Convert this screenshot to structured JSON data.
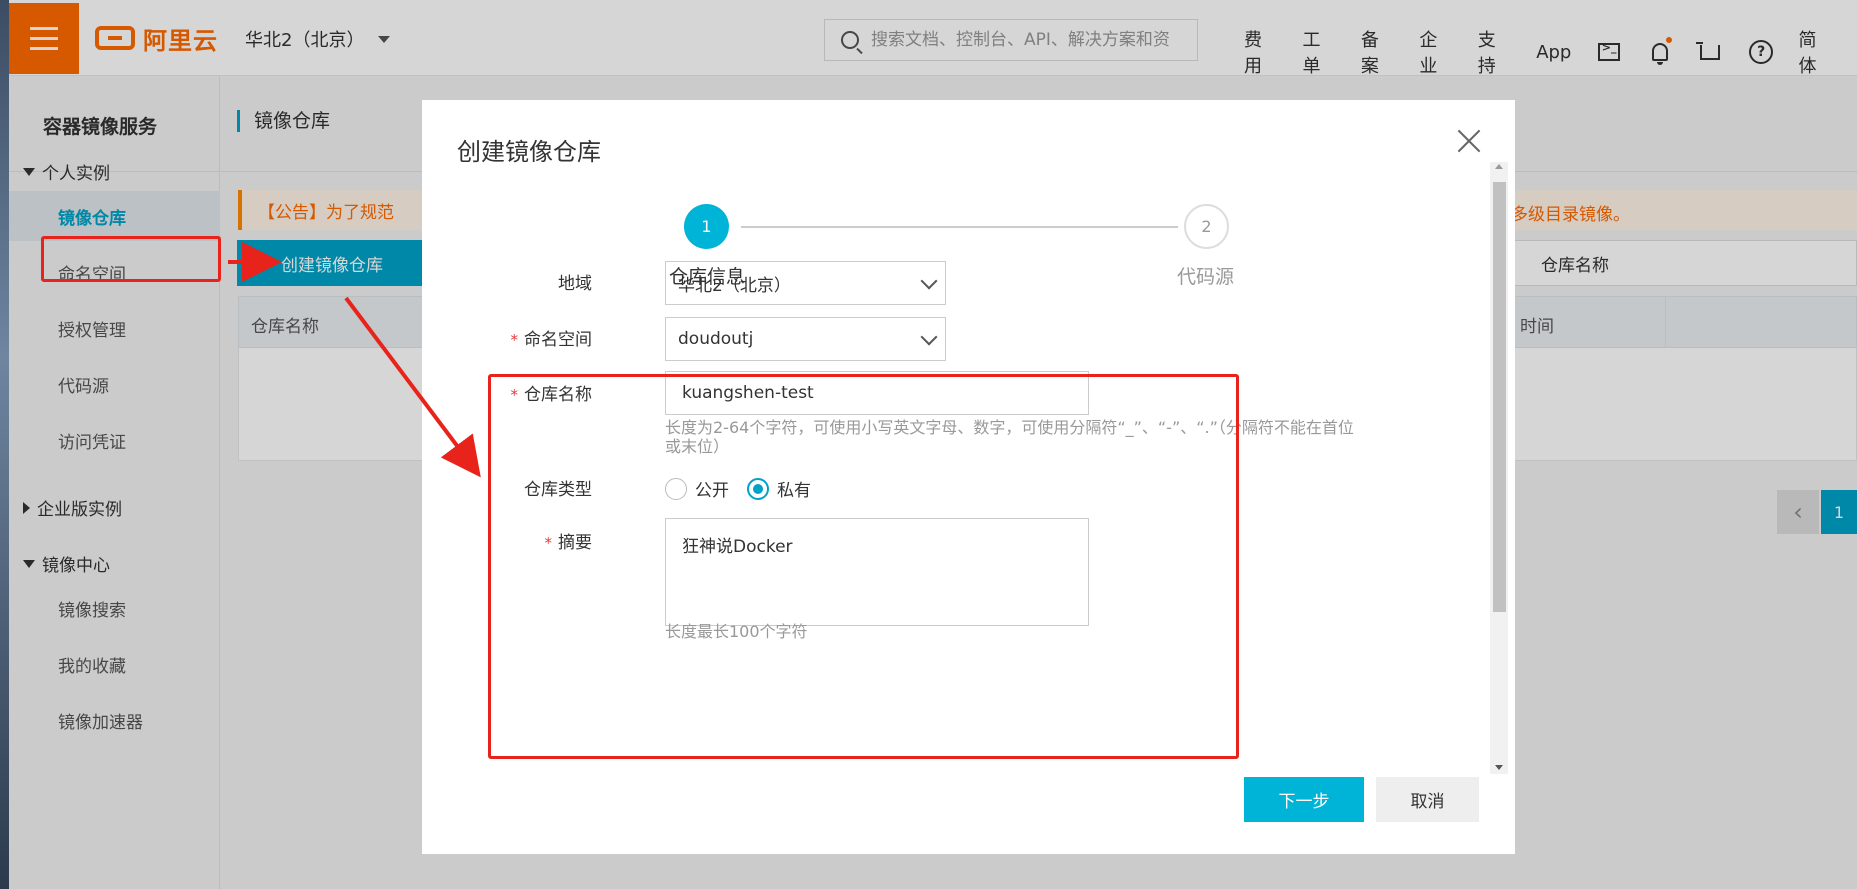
{
  "topbar": {
    "logo_text": "阿里云",
    "region": "华北2（北京）",
    "search_placeholder": "搜索文档、控制台、API、解决方案和资",
    "nav_items": [
      "费用",
      "工单",
      "备案",
      "企业",
      "支持",
      "App"
    ],
    "lang": "简体",
    "brand_color": "#ff6a00"
  },
  "sidebar": {
    "title": "容器镜像服务",
    "group_personal": "个人实例",
    "items_personal": [
      "镜像仓库",
      "命名空间",
      "授权管理",
      "代码源",
      "访问凭证"
    ],
    "group_enterprise": "企业版实例",
    "group_center": "镜像中心",
    "items_center": [
      "镜像搜索",
      "我的收藏",
      "镜像加速器"
    ]
  },
  "main": {
    "title": "镜像仓库",
    "notice": "【公告】为了规范",
    "notice_tail": "多级目录镜像。",
    "create_button": "创建镜像仓库",
    "filter_label": "仓库名称",
    "table_header_left": "仓库名称",
    "table_header_right": "时间",
    "pager_current": "1"
  },
  "modal": {
    "title": "创建镜像仓库",
    "step1_number": "1",
    "step1_label": "仓库信息",
    "step2_number": "2",
    "step2_label": "代码源",
    "region_label": "地域",
    "region_value": "华北2（北京）",
    "namespace_label": "命名空间",
    "namespace_value": "doudoutj",
    "repo_name_label": "仓库名称",
    "repo_name_value": "kuangshen-test",
    "repo_name_hint_1": "长度为2-64个字符，可使用小写英文字母、数字，可使用分隔符“_”、“-”、“.”（分隔符不能在首位",
    "repo_name_hint_2": "或末位）",
    "repo_type_label": "仓库类型",
    "repo_type_public": "公开",
    "repo_type_private": "私有",
    "repo_type_selected": "私有",
    "summary_label": "摘要",
    "summary_value": "狂神说Docker",
    "summary_hint": "长度最长100个字符",
    "required_mark": "*",
    "next_button": "下一步",
    "cancel_button": "取消",
    "accent_color": "#00b4d8"
  },
  "annotation": {
    "color": "#e8231c"
  }
}
